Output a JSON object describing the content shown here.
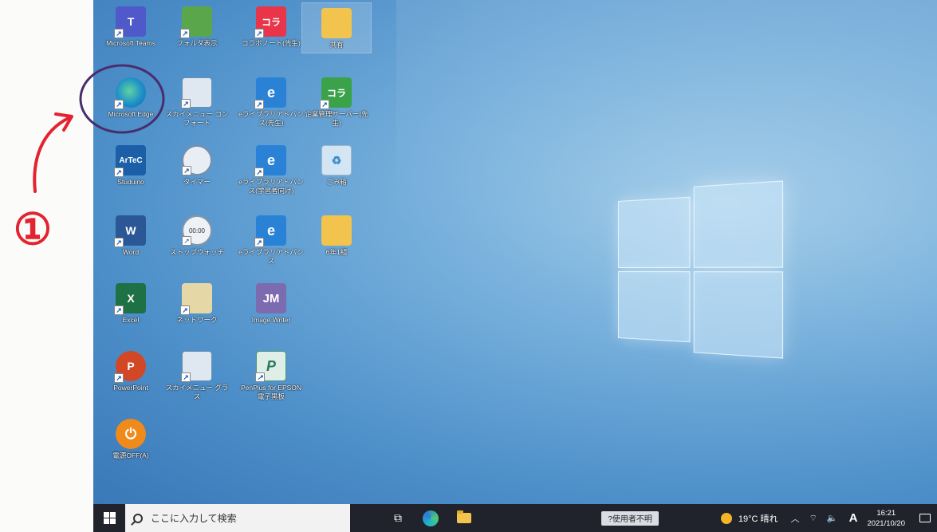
{
  "annotation": {
    "number": "①"
  },
  "desktop": {
    "icons": [
      {
        "label": "Microsoft Teams",
        "glyph": "T",
        "color": "#5059c9",
        "icon": "teams-icon"
      },
      {
        "label": "フォルダ表示",
        "glyph": "",
        "color": "#5aa64a",
        "icon": "folder-view-icon"
      },
      {
        "label": "コラボノート(先生)",
        "glyph": "コラ",
        "color": "#e8354a",
        "icon": "collabonote-icon"
      },
      {
        "label": "共有",
        "glyph": "",
        "color": "#f2c34d",
        "icon": "shared-folder-icon"
      },
      {
        "label": "Microsoft Edge",
        "glyph": "",
        "color": "#1e90c8",
        "icon": "edge-icon"
      },
      {
        "label": "スカイメニュー コンフォート",
        "glyph": "",
        "color": "#6a8fb0",
        "icon": "skymenu-icon"
      },
      {
        "label": "eライブラリアドバンス(先生)",
        "glyph": "e",
        "color": "#2a82d6",
        "icon": "elibrary-icon"
      },
      {
        "label": "企業管理サーバー(先生)",
        "glyph": "コラ",
        "color": "#3aa34a",
        "icon": "collabonote-server-icon"
      },
      {
        "label": "Studuino",
        "glyph": "ArTeC",
        "color": "#1a5fa8",
        "icon": "studuino-icon"
      },
      {
        "label": "タイマー",
        "glyph": "",
        "color": "#7a8ea8",
        "icon": "timer-icon"
      },
      {
        "label": "eライブラリアドバンス(学習者向け)",
        "glyph": "e",
        "color": "#2a82d6",
        "icon": "elibrary-learner-icon"
      },
      {
        "label": "ごみ箱",
        "glyph": "",
        "color": "#9cb8cc",
        "icon": "recycle-bin-icon"
      },
      {
        "label": "Word",
        "glyph": "W",
        "color": "#2b5797",
        "icon": "word-icon"
      },
      {
        "label": "ストップウォッチ",
        "glyph": "00:00",
        "color": "#8896a8",
        "icon": "stopwatch-icon"
      },
      {
        "label": "eライブラリアドバンス",
        "glyph": "e",
        "color": "#2a82d6",
        "icon": "elibrary-advance-icon"
      },
      {
        "label": "6年1組",
        "glyph": "",
        "color": "#f2c34d",
        "icon": "class-folder-icon"
      },
      {
        "label": "Excel",
        "glyph": "X",
        "color": "#1e7145",
        "icon": "excel-icon"
      },
      {
        "label": "ネットワーク",
        "glyph": "",
        "color": "#c9a24a",
        "icon": "network-icon"
      },
      {
        "label": "Image Writer",
        "glyph": "JM",
        "color": "#7d6bb0",
        "icon": "image-writer-icon"
      },
      {
        "label": "PowerPoint",
        "glyph": "P",
        "color": "#d24726",
        "icon": "powerpoint-icon"
      },
      {
        "label": "スカイメニュー グラス",
        "glyph": "",
        "color": "#6a8fb0",
        "icon": "skymenu-class-icon"
      },
      {
        "label": "PenPlus for EPSON 電子黒板",
        "glyph": "P",
        "color": "#4a9a7a",
        "icon": "penplus-icon"
      },
      {
        "label": "電源OFF(A)",
        "glyph": "⏻",
        "color": "#f08a1a",
        "icon": "power-off-icon"
      }
    ]
  },
  "taskbar": {
    "search_placeholder": "ここに入力して検索",
    "notice": "?使用者不明",
    "weather": "19°C 晴れ",
    "ime": "A",
    "time": "16:21",
    "date": "2021/10/20"
  }
}
